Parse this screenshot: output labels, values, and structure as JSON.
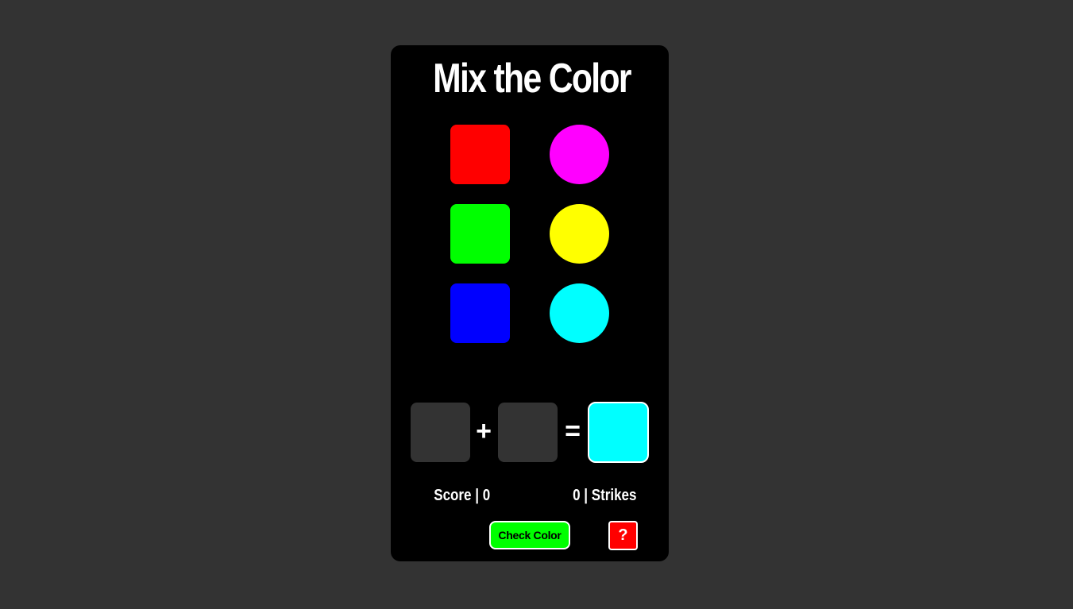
{
  "game": {
    "title": "Mix the Color"
  },
  "palette": {
    "squares": [
      {
        "name": "red",
        "color": "#ff0000"
      },
      {
        "name": "green",
        "color": "#00ff00"
      },
      {
        "name": "blue",
        "color": "#0000ff"
      }
    ],
    "circles": [
      {
        "name": "magenta",
        "color": "#ff00ff"
      },
      {
        "name": "yellow",
        "color": "#ffff00"
      },
      {
        "name": "cyan",
        "color": "#00ffff"
      }
    ]
  },
  "equation": {
    "slot_color": "#333333",
    "plus": "+",
    "equals": "=",
    "target_color": "#00ffff"
  },
  "stats": {
    "score_text": "Score | 0",
    "strikes_text": "0 | Strikes"
  },
  "controls": {
    "check_label": "Check Color",
    "check_color": "#00ff00",
    "help_label": "?",
    "help_color": "#ff0000"
  }
}
